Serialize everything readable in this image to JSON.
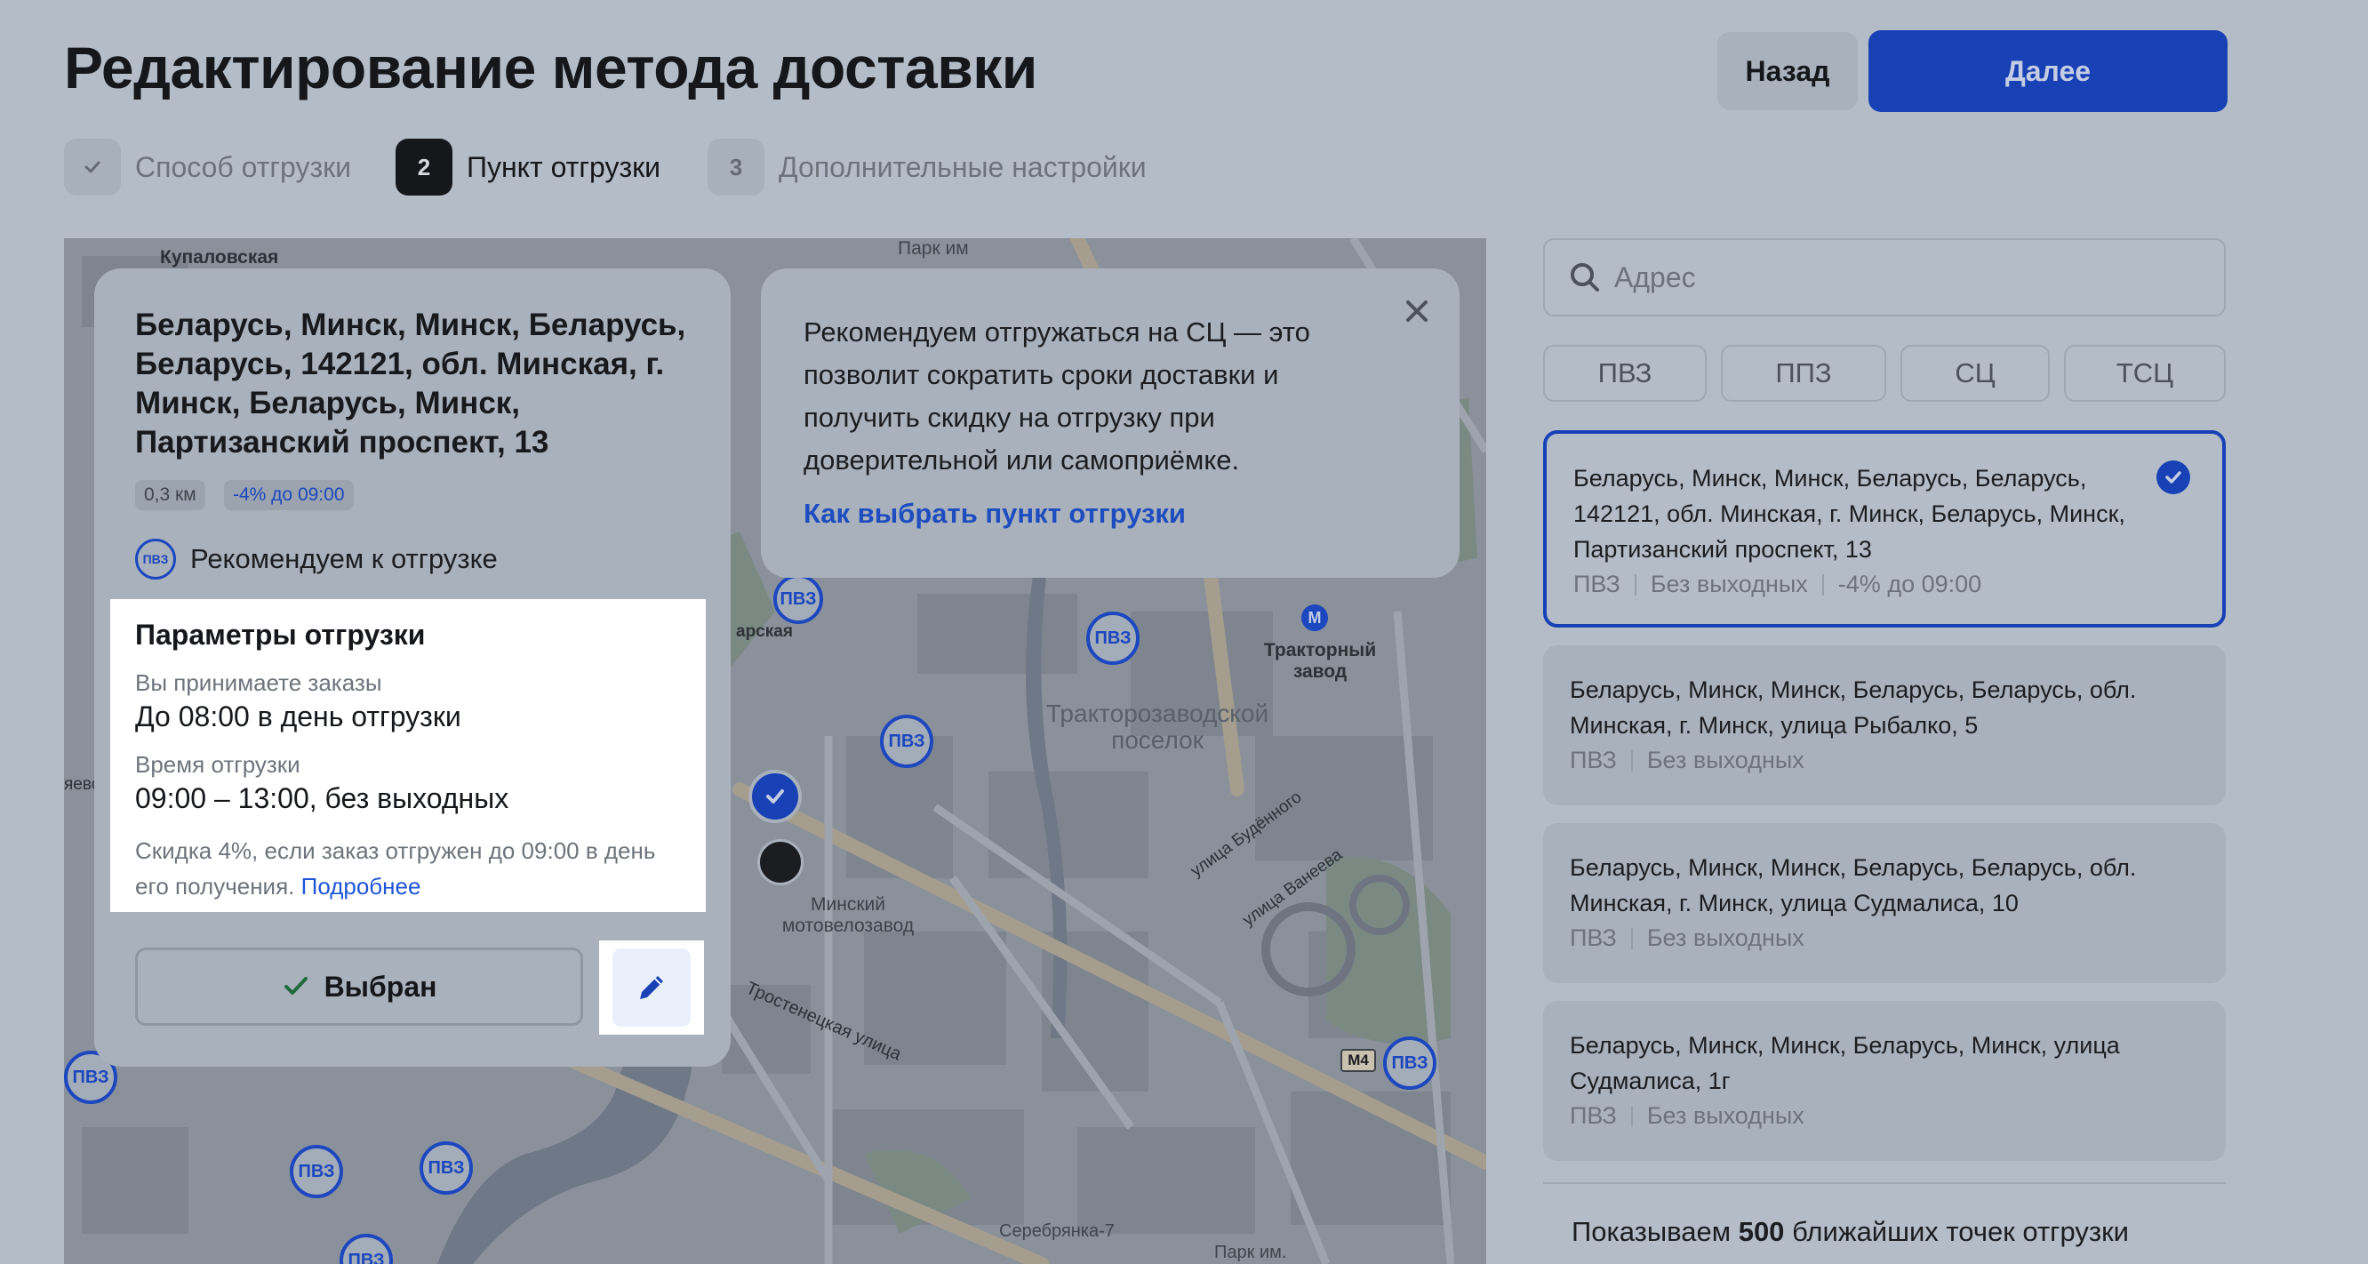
{
  "header": {
    "title": "Редактирование метода доставки",
    "back_label": "Назад",
    "next_label": "Далее"
  },
  "steps": [
    {
      "badge": "✓",
      "label": "Способ отгрузки",
      "state": "done"
    },
    {
      "badge": "2",
      "label": "Пункт отгрузки",
      "state": "active"
    },
    {
      "badge": "3",
      "label": "Дополнительные настройки",
      "state": "upcoming"
    }
  ],
  "map": {
    "labels": [
      "Купаловская",
      "Парк им",
      "Тракторный завод",
      "Тракторозаводской поселок",
      "Минский мотовелозавод",
      "Тростенецкая улица",
      "улица Будённого",
      "улица Ванеева",
      "M4",
      "Серебрянка-7",
      "Парк им.",
      "арская",
      "яево"
    ],
    "point_label": "ПВЗ"
  },
  "point_card": {
    "address": "Беларусь, Минск, Минск, Беларусь, Беларусь, 142121, обл. Минская, г. Минск, Беларусь, Минск, Партизанский проспект, 13",
    "distance": "0,3 км",
    "discount": "-4% до 09:00",
    "type_badge": "ПВЗ",
    "recommend": "Рекомендуем к отгрузке",
    "params": {
      "title": "Параметры отгрузки",
      "accept_label": "Вы принимаете заказы",
      "accept_value": "До 08:00 в день отгрузки",
      "time_label": "Время отгрузки",
      "time_value": "09:00 – 13:00, без выходных",
      "note": "Скидка 4%, если заказ отгружен до 09:00 в день его получения.",
      "more_link": "Подробнее"
    },
    "selected_label": "Выбран"
  },
  "tip": {
    "text": "Рекомендуем отгружаться на СЦ — это позволит сократить сроки доставки и получить скидку на отгрузку при доверительной или самоприёмке.",
    "link": "Как выбрать пункт отгрузки"
  },
  "search": {
    "placeholder": "Адрес",
    "value": ""
  },
  "filters": [
    "ПВЗ",
    "ППЗ",
    "СЦ",
    "ТСЦ"
  ],
  "list": [
    {
      "address": "Беларусь, Минск, Минск, Беларусь, Беларусь, 142121, обл. Минская, г. Минск, Беларусь, Минск, Партизанский проспект, 13",
      "type": "ПВЗ",
      "schedule": "Без выходных",
      "discount": "-4% до 09:00",
      "selected": true
    },
    {
      "address": "Беларусь, Минск, Минск, Беларусь, Беларусь, обл. Минская, г. Минск, улица Рыбалко, 5",
      "type": "ПВЗ",
      "schedule": "Без выходных",
      "selected": false
    },
    {
      "address": "Беларусь, Минск, Минск, Беларусь, Беларусь, обл. Минская, г. Минск, улица Судмалиса, 10",
      "type": "ПВЗ",
      "schedule": "Без выходных",
      "selected": false
    },
    {
      "address": "Беларусь, Минск, Минск, Беларусь, Минск, улица Судмалиса, 1г",
      "type": "ПВЗ",
      "schedule": "Без выходных",
      "selected": false
    }
  ],
  "footer": {
    "prefix": "Показываем",
    "count": "500",
    "suffix": "ближайших точек отгрузки"
  },
  "colors": {
    "accent": "#1741b5",
    "link": "#1e55d8",
    "overlay": "#b4bcc7"
  }
}
